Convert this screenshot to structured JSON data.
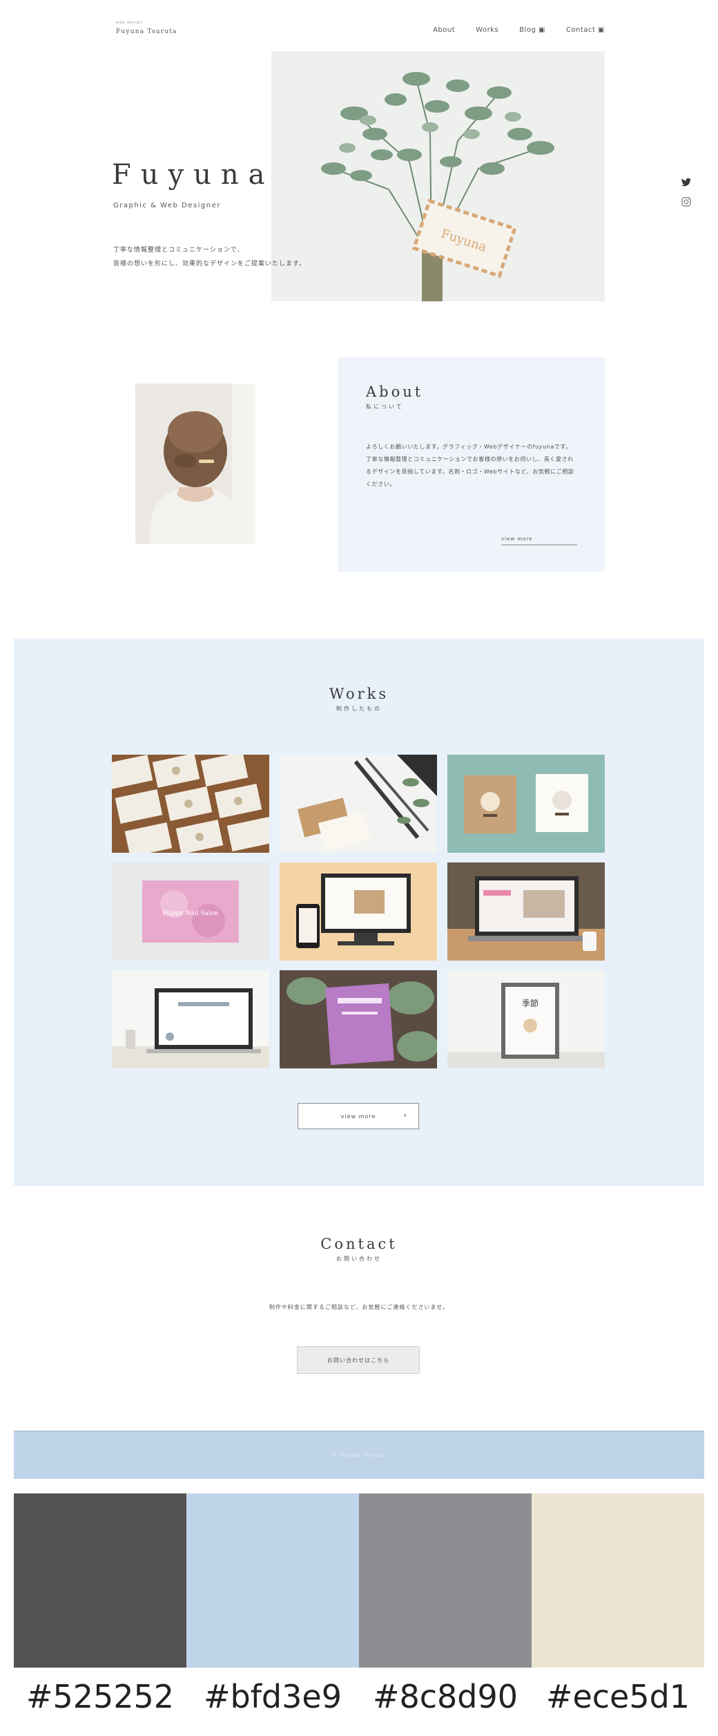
{
  "header": {
    "logo_sub": "web design",
    "logo_main": "Fuyuna Tsuruta",
    "nav": [
      {
        "label": "About"
      },
      {
        "label": "Works"
      },
      {
        "label": "Blog ▣"
      },
      {
        "label": "Contact ▣"
      }
    ]
  },
  "hero": {
    "title": "Fuyuna",
    "subtitle": "Graphic & Web Designer",
    "desc_line1": "丁寧な情報整理とコミュニケーションで、",
    "desc_line2": "皆様の想いを形にし、効果的なデザインをご提案いたします。",
    "card_text": "Fuyuna"
  },
  "social": {
    "icons": [
      "twitter-icon",
      "instagram-icon"
    ]
  },
  "about": {
    "title": "About",
    "subtitle": "私について",
    "text": "よろしくお願いいたします。グラフィック・Webデザイナーのfuyunaです。丁寧な情報整理とコミュニケーションでお客様の想いをお伺いし、長く愛されるデザインを目指しています。名刺・ロゴ・Webサイトなど、お気軽にご相談ください。",
    "more": "view more"
  },
  "works": {
    "title": "Works",
    "subtitle": "制作したもの",
    "tiles": [
      {
        "label": "business-cards-photo"
      },
      {
        "label": "kraft-card-photo"
      },
      {
        "label": "teal-cards-photo"
      },
      {
        "label": "pink-card-photo",
        "card_text": "Happy Nail Salon"
      },
      {
        "label": "responsive-site-photo"
      },
      {
        "label": "laptop-cafe-photo"
      },
      {
        "label": "laptop-white-photo"
      },
      {
        "label": "purple-sign-photo"
      },
      {
        "label": "framed-poster-photo",
        "poster_text": "季節"
      }
    ],
    "more": "view more",
    "more_arrow": "›"
  },
  "contact": {
    "title": "Contact",
    "subtitle": "お問い合わせ",
    "lead": "制作や料金に関するご相談など、お気軽にご連絡くださいませ。",
    "button": "お問い合わせはこちら"
  },
  "footer": {
    "text": "© Fuyuna Tsuruta"
  },
  "palette": {
    "swatches": [
      {
        "hex": "#525252"
      },
      {
        "hex": "#bfd3e9"
      },
      {
        "hex": "#8c8d90"
      },
      {
        "hex": "#ece5d1"
      }
    ]
  }
}
